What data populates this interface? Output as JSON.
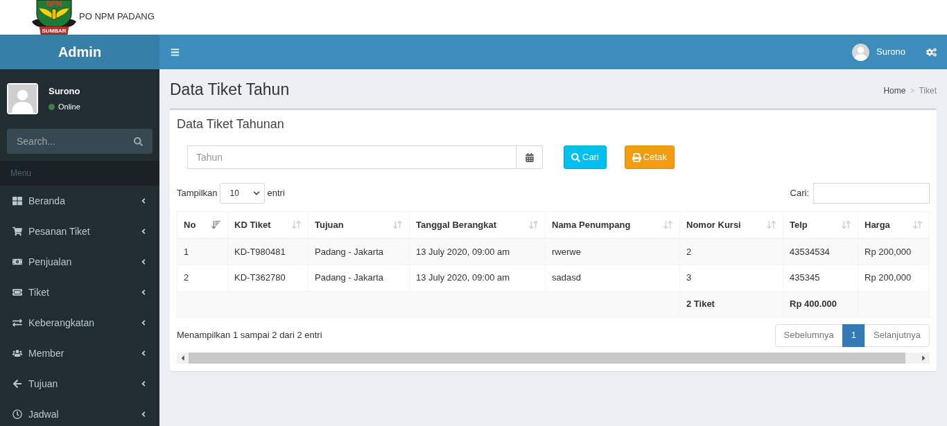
{
  "brand": {
    "logo_text": "NPM",
    "logo_ribbon": "SUMBAR",
    "name": "PO NPM PADANG"
  },
  "navbar": {
    "app_title": "Admin",
    "user_name": "Surono"
  },
  "sidebar": {
    "user": {
      "name": "Surono",
      "status": "Online"
    },
    "search": {
      "placeholder": "Search..."
    },
    "menu_header": "Menu",
    "items": [
      {
        "label": "Beranda"
      },
      {
        "label": "Pesanan Tiket"
      },
      {
        "label": "Penjualan"
      },
      {
        "label": "Tiket"
      },
      {
        "label": "Keberangkatan"
      },
      {
        "label": "Member"
      },
      {
        "label": "Tujuan"
      },
      {
        "label": "Jadwal"
      }
    ]
  },
  "page": {
    "title": "Data Tiket Tahun",
    "breadcrumb": [
      {
        "label": "Home",
        "current": false
      },
      {
        "label": "Tiket",
        "current": true
      }
    ],
    "breadcrumb_separator": ">"
  },
  "box": {
    "title": "Data Tiket Tahunan",
    "year_field": {
      "placeholder": "Tahun"
    },
    "buttons": [
      {
        "label": "Cari",
        "kind": "search"
      },
      {
        "label": "Cetak",
        "kind": "print"
      }
    ]
  },
  "table_controls": {
    "length_prefix": "Tampilkan",
    "length_value": "10",
    "length_suffix": "entri",
    "search_label": "Cari:"
  },
  "table": {
    "columns": [
      {
        "label": "No",
        "sorted": true
      },
      {
        "label": "KD Tiket",
        "sorted": false
      },
      {
        "label": "Tujuan",
        "sorted": false
      },
      {
        "label": "Tanggal Berangkat",
        "sorted": false
      },
      {
        "label": "Nama Penumpang",
        "sorted": false
      },
      {
        "label": "Nomor Kursi",
        "sorted": false
      },
      {
        "label": "Telp",
        "sorted": false
      },
      {
        "label": "Harga",
        "sorted": false
      }
    ],
    "rows": [
      [
        "1",
        "KD-T980481",
        "Padang - Jakarta",
        "13 July 2020, 09:00 am",
        "rwerwe",
        "2",
        "43534534",
        "Rp 200,000"
      ],
      [
        "2",
        "KD-T362780",
        "Padang - Jakarta",
        "13 July 2020, 09:00 am",
        "sadasd",
        "3",
        "435345",
        "Rp 200,000"
      ]
    ],
    "footer": {
      "seat_total": "2 Tiket",
      "price_total": "Rp 400.000"
    }
  },
  "info": "Menampilkan 1 sampai 2 dari 2 entri",
  "pagination": [
    {
      "label": "Sebelumnya",
      "selected": false,
      "disabled": true
    },
    {
      "label": "1",
      "selected": true,
      "disabled": false
    },
    {
      "label": "Selanjutnya",
      "selected": false,
      "disabled": true
    }
  ]
}
